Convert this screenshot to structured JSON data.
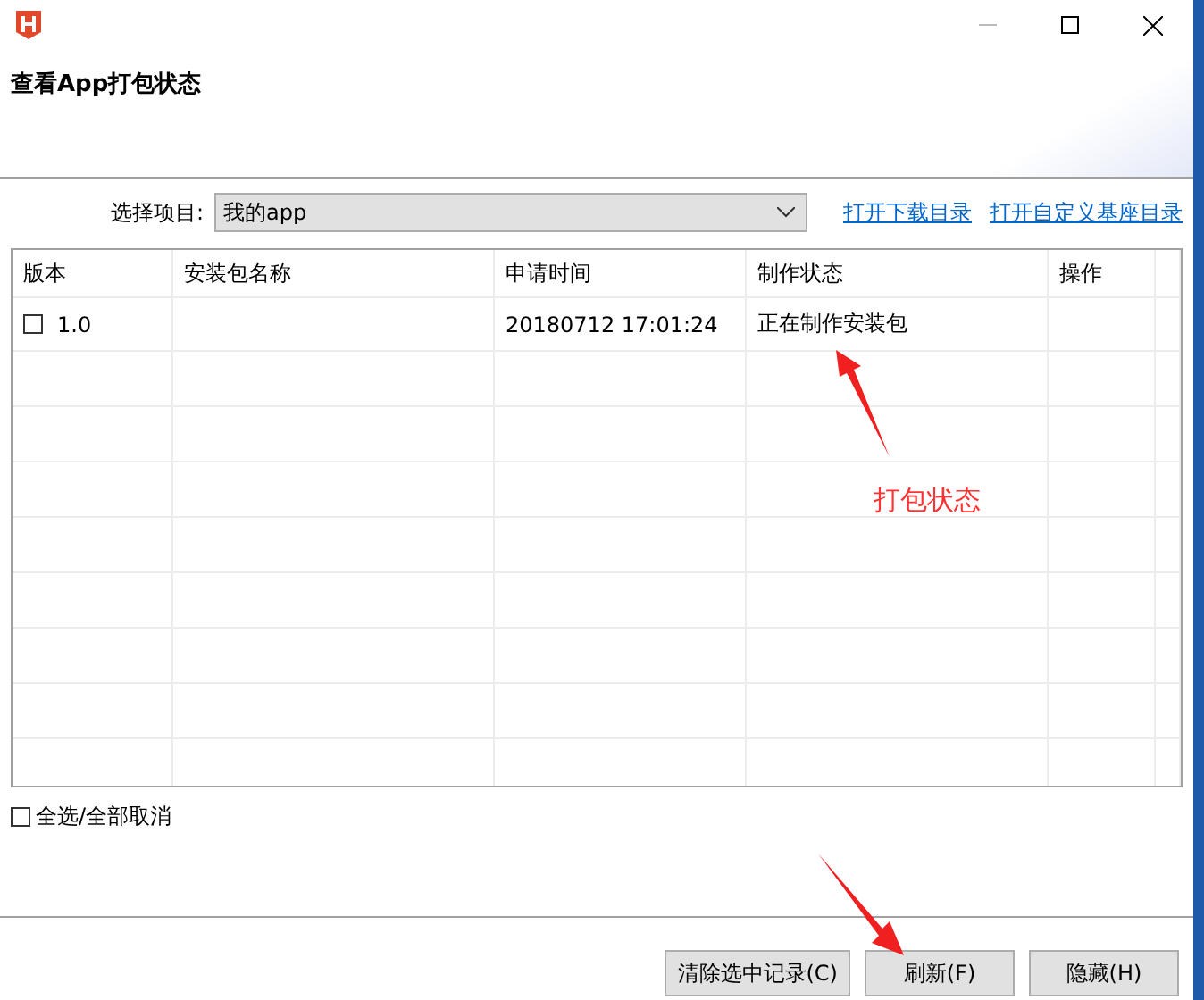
{
  "window": {
    "title": "查看App打包状态"
  },
  "project": {
    "label": "选择项目:",
    "value": "我的app"
  },
  "links": [
    "打开下载目录",
    "打开自定义基座目录"
  ],
  "table": {
    "columns": [
      "版本",
      "安装包名称",
      "申请时间",
      "制作状态",
      "操作"
    ],
    "rows": [
      {
        "checked": false,
        "cells": [
          "1.0",
          "",
          "20180712 17:01:24",
          "正在制作安装包",
          ""
        ]
      }
    ]
  },
  "select_all": {
    "label": "全选/全部取消",
    "checked": false
  },
  "annotation": "打包状态",
  "buttons": [
    "清除选中记录(C)",
    "刷新(F)",
    "隐藏(H)"
  ]
}
